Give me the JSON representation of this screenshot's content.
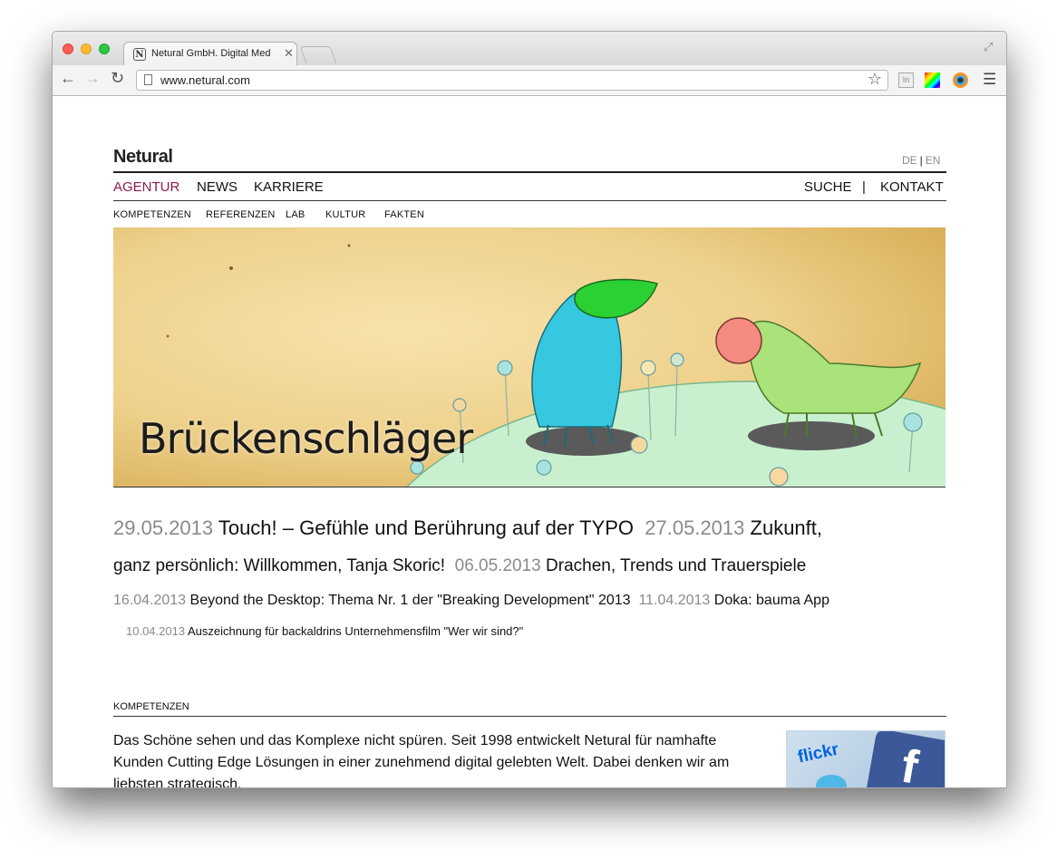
{
  "browser": {
    "tab_title": "Netural GmbH. Digital Med",
    "tab_favicon": "N",
    "url": "www.netural.com",
    "icons": [
      "back-arrow-icon",
      "forward-arrow-icon",
      "reload-icon",
      "page-icon",
      "bookmark-star-icon",
      "linkedin-extension-icon",
      "color-extension-icon",
      "eye-extension-icon",
      "menu-icon",
      "fullscreen-icon"
    ]
  },
  "site": {
    "logo": "Netural",
    "lang": {
      "de": "DE",
      "sep": "|",
      "en": "EN"
    },
    "nav": {
      "agentur": "AGENTUR",
      "news": "NEWS",
      "karriere": "KARRIERE",
      "suche": "SUCHE",
      "sep": "|",
      "kontakt": "KONTAKT"
    },
    "subnav": [
      "KOMPETENZEN",
      "REFERENZEN",
      "LAB",
      "KULTUR",
      "FAKTEN"
    ],
    "hero_title": "Brückenschläger",
    "news": [
      {
        "date": "29.05.2013",
        "title": "Touch! – Gefühle und Berührung auf der TYPO"
      },
      {
        "date": "27.05.2013",
        "title": "Zukunft,"
      },
      {
        "cont": "ganz persönlich: Willkommen, Tanja Skoric!"
      },
      {
        "date": "06.05.2013",
        "title": "Drachen, Trends und Trauerspiele"
      },
      {
        "date": "16.04.2013",
        "title": "Beyond the Desktop: Thema Nr. 1 der \"Breaking Development\" 2013"
      },
      {
        "date": "11.04.2013",
        "title": "Doka: bauma App"
      },
      {
        "date": "10.04.2013",
        "title": "Auszeichnung für backaldrins Unternehmensfilm \"Wer wir sind?\""
      }
    ],
    "section_label": "KOMPETENZEN",
    "body_text": "Das Schöne sehen und das Komplexe nicht spüren. Seit 1998 entwickelt Netural für namhafte Kunden Cutting Edge Lösungen in einer zunehmend digital gelebten Welt. Dabei denken wir am liebsten strategisch.",
    "social_flickr": "flickr",
    "social_fb": "f"
  },
  "colors": {
    "accent": "#8b1c4c",
    "date_gray": "#8a8a8a",
    "hero_paper": "#f1d79a"
  }
}
